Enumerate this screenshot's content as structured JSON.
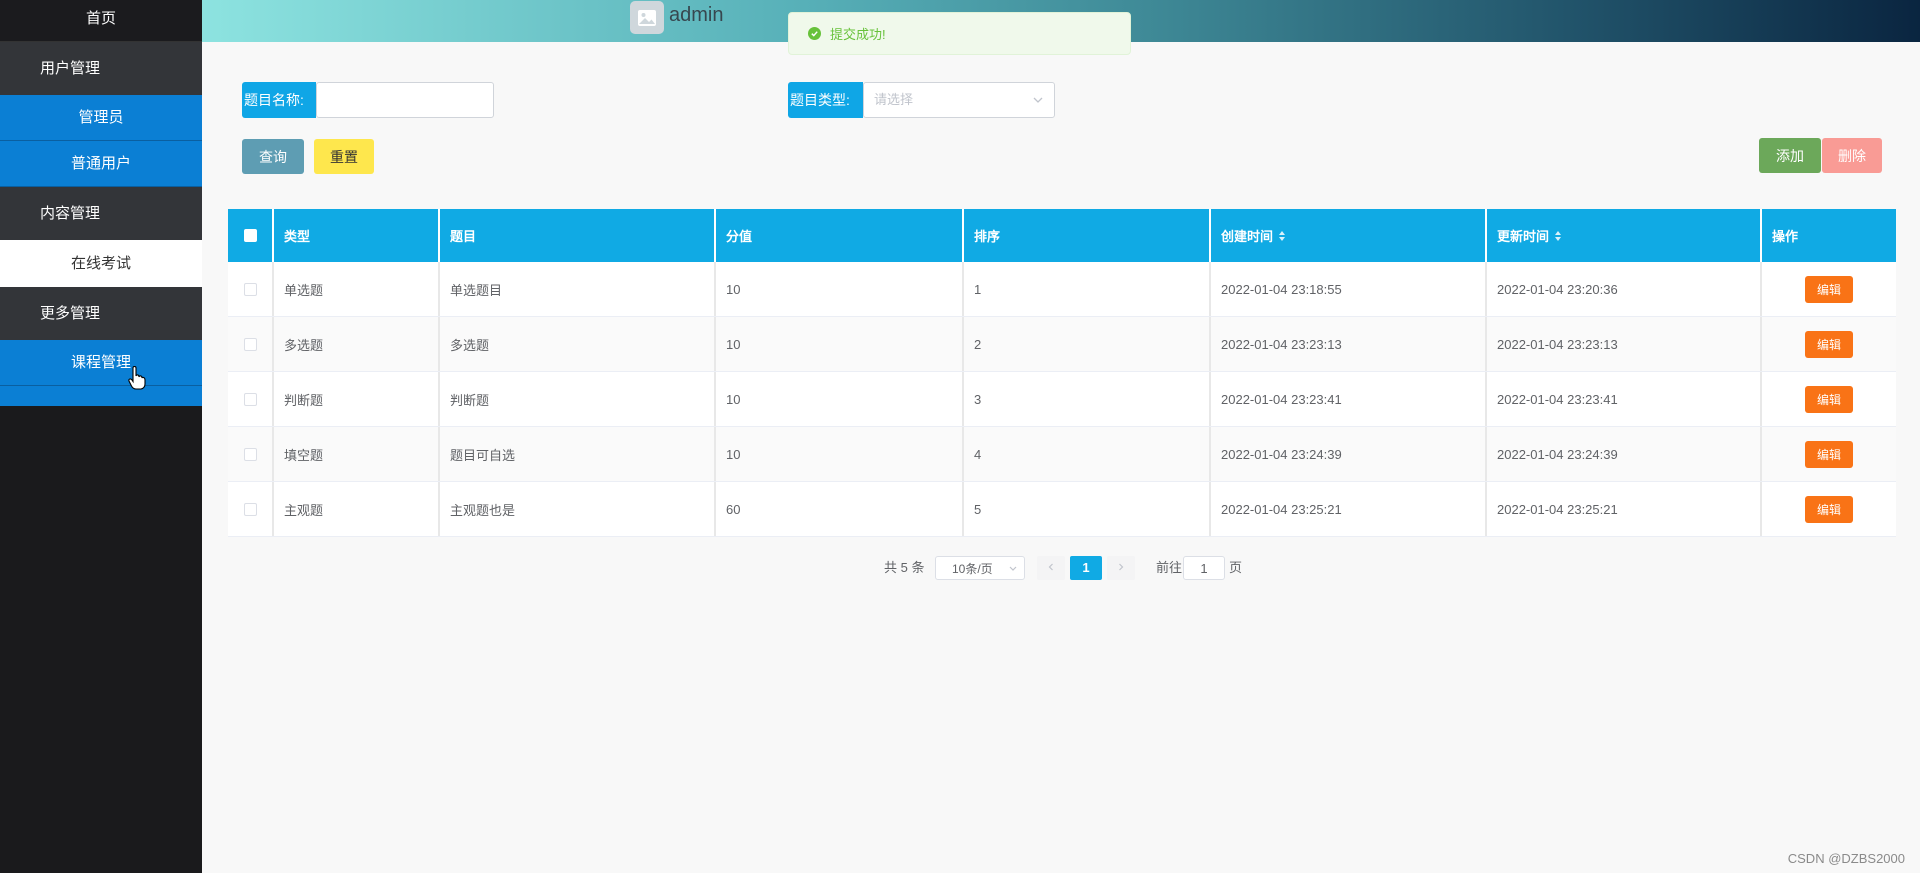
{
  "sidebar": {
    "home": "首页",
    "groups": [
      {
        "label": "用户管理",
        "items": [
          "管理员",
          "普通用户"
        ]
      },
      {
        "label": "内容管理",
        "items": [
          "在线考试"
        ]
      },
      {
        "label": "更多管理",
        "items": [
          "课程管理"
        ]
      }
    ]
  },
  "header": {
    "username": "admin"
  },
  "toast": {
    "message": "提交成功!"
  },
  "search": {
    "name_label": "题目名称:",
    "name_value": "",
    "type_label": "题目类型:",
    "type_placeholder": "请选择",
    "query_label": "查询",
    "reset_label": "重置"
  },
  "actions": {
    "add_label": "添加",
    "delete_label": "删除"
  },
  "colors": {
    "sidebar_bg": "#1a1a1c",
    "primary": "#10aae4",
    "query": "#5e9db3",
    "reset": "#fee74d",
    "add": "#6ca85a",
    "delete": "#f99b95",
    "edit": "#f97316",
    "success": "#67c23a"
  },
  "table": {
    "columns": [
      "类型",
      "题目",
      "分值",
      "排序",
      "创建时间",
      "更新时间",
      "操作"
    ],
    "rows": [
      {
        "type": "单选题",
        "title": "单选题目",
        "score": "10",
        "order": "1",
        "created": "2022-01-04 23:18:55",
        "updated": "2022-01-04 23:20:36",
        "action": "编辑"
      },
      {
        "type": "多选题",
        "title": "多选题",
        "score": "10",
        "order": "2",
        "created": "2022-01-04 23:23:13",
        "updated": "2022-01-04 23:23:13",
        "action": "编辑"
      },
      {
        "type": "判断题",
        "title": "判断题",
        "score": "10",
        "order": "3",
        "created": "2022-01-04 23:23:41",
        "updated": "2022-01-04 23:23:41",
        "action": "编辑"
      },
      {
        "type": "填空题",
        "title": "题目可自选",
        "score": "10",
        "order": "4",
        "created": "2022-01-04 23:24:39",
        "updated": "2022-01-04 23:24:39",
        "action": "编辑"
      },
      {
        "type": "主观题",
        "title": "主观题也是",
        "score": "60",
        "order": "5",
        "created": "2022-01-04 23:25:21",
        "updated": "2022-01-04 23:25:21",
        "action": "编辑"
      }
    ]
  },
  "pagination": {
    "total_text": "共 5 条",
    "page_size": "10条/页",
    "current_page": "1",
    "goto_label": "前往",
    "goto_value": "1",
    "page_suffix": "页"
  },
  "watermark": "CSDN @DZBS2000"
}
